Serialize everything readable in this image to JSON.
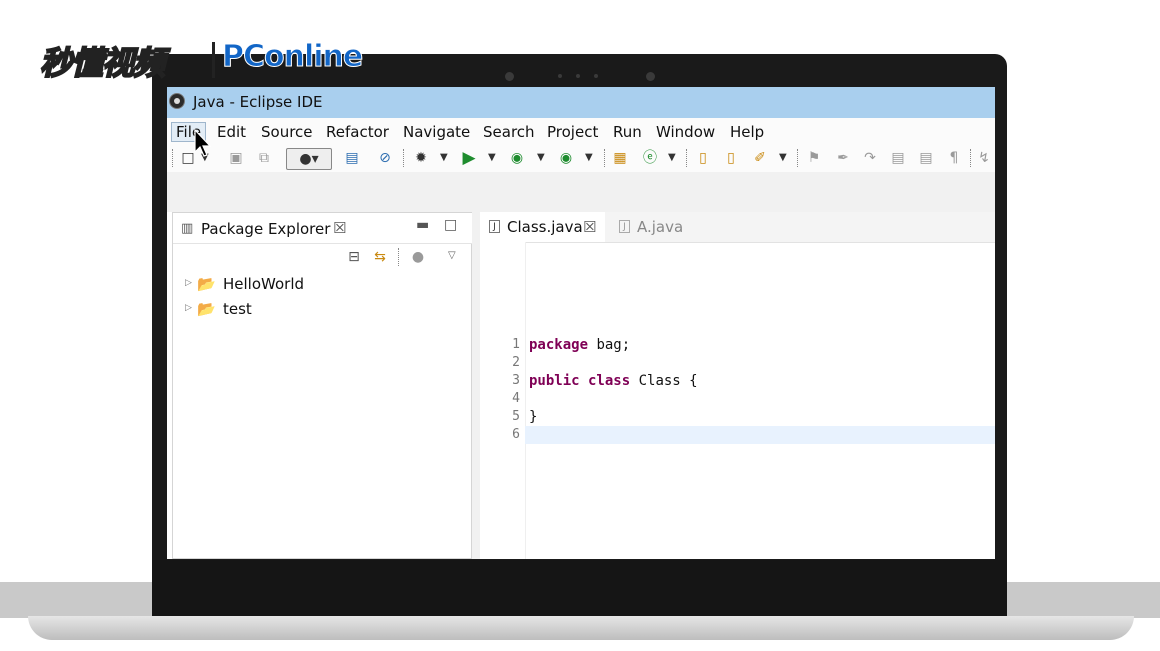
{
  "watermark": {
    "brand_cn": "秒懂视频",
    "brand_pc": "PConline"
  },
  "window": {
    "title": "Java - Eclipse IDE"
  },
  "menu": [
    "File",
    "Edit",
    "Source",
    "Refactor",
    "Navigate",
    "Search",
    "Project",
    "Run",
    "Window",
    "Help"
  ],
  "toolbar_icons": [
    "new-icon",
    "save-icon",
    "save-all-icon",
    "user-icon",
    "console-icon",
    "skip-breakpoints-icon",
    "debug-icon",
    "run-icon",
    "run-as-icon",
    "external-tools-icon",
    "new-java-project-icon",
    "new-class-icon",
    "open-type-icon",
    "open-folder-icon",
    "search-icon",
    "annotation-icon",
    "highlight-icon",
    "show-whitespace-icon"
  ],
  "package_explorer": {
    "tab_label": "Package Explorer",
    "items": [
      {
        "label": "HelloWorld",
        "icon": "java-project-icon"
      },
      {
        "label": "test",
        "icon": "java-project-error-icon"
      }
    ]
  },
  "editor": {
    "tabs": [
      {
        "label": "Class.java",
        "active": true
      },
      {
        "label": "A.java",
        "active": false
      }
    ],
    "lines": [
      {
        "n": "1",
        "kw": "package",
        "rest": " bag;"
      },
      {
        "n": "2",
        "kw": "",
        "rest": ""
      },
      {
        "n": "3",
        "kw": "public class",
        "rest": " Class {"
      },
      {
        "n": "4",
        "kw": "",
        "rest": ""
      },
      {
        "n": "5",
        "kw": "",
        "rest": "}"
      },
      {
        "n": "6",
        "kw": "",
        "rest": ""
      }
    ],
    "current_line": "6"
  },
  "colors": {
    "titlebar": "#a9cfee",
    "keyword": "#7f0055",
    "current_line": "#e8f2fe"
  }
}
